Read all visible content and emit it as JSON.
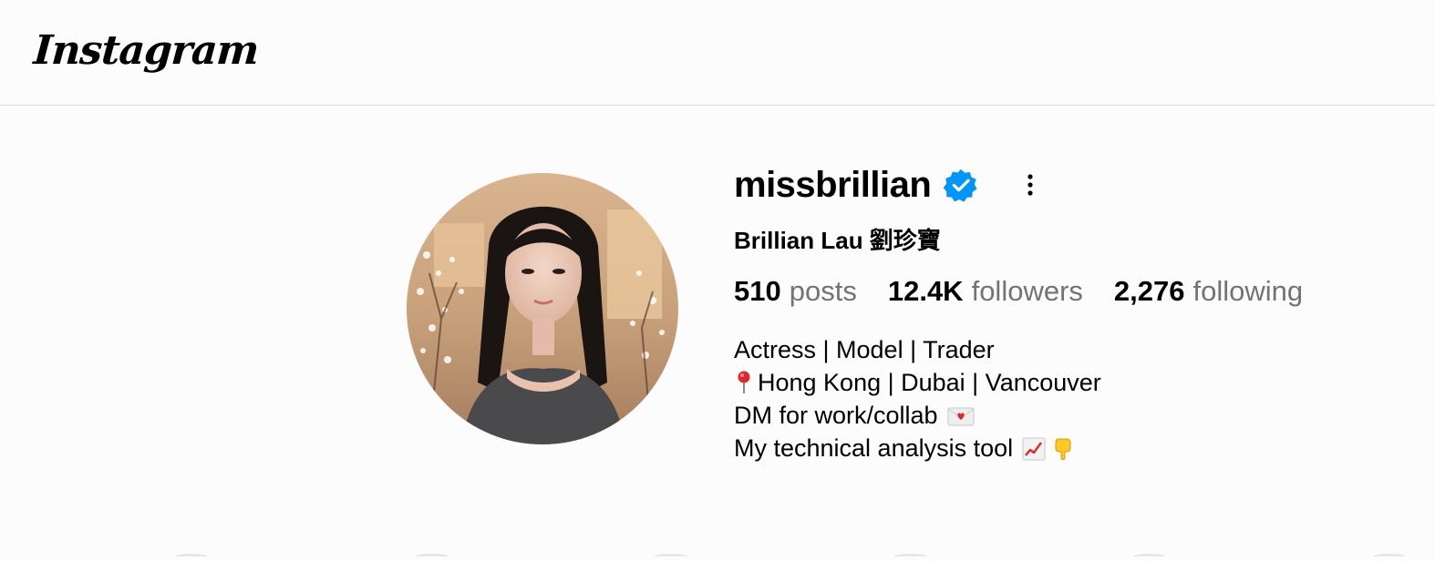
{
  "header": {
    "logo_text": "Instagram"
  },
  "profile": {
    "username": "missbrillian",
    "verified": true,
    "full_name": "Brillian Lau 劉珍寶",
    "stats": [
      {
        "value": "510",
        "label": "posts"
      },
      {
        "value": "12.4K",
        "label": "followers"
      },
      {
        "value": "2,276",
        "label": "following"
      }
    ],
    "bio": {
      "line1": "Actress | Model | Trader",
      "line2": "Hong Kong | Dubai | Vancouver",
      "line3": "DM for work/collab",
      "line4": "My technical analysis tool"
    }
  },
  "icons": {
    "verified": "verified-badge-icon",
    "more": "more-options-icon",
    "pin": "round-pushpin-icon",
    "envelope": "love-letter-icon",
    "chart": "chart-increasing-icon",
    "point_down": "backhand-index-pointing-down-icon"
  },
  "colors": {
    "verified_blue": "#0095f6",
    "secondary_text": "#737373",
    "divider": "#d9d9d9",
    "background": "#fdfcfd"
  }
}
